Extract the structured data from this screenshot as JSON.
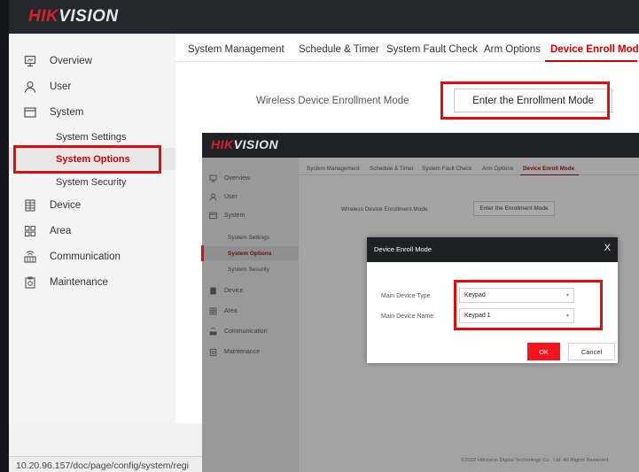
{
  "brand": {
    "logo_hik": "HIK",
    "logo_vision": "VISION"
  },
  "sidebar": {
    "items": [
      {
        "label": "Overview",
        "icon": "monitor-icon"
      },
      {
        "label": "User",
        "icon": "user-icon"
      },
      {
        "label": "System",
        "icon": "window-icon"
      },
      {
        "label": "Device",
        "icon": "device-grid-icon"
      },
      {
        "label": "Area",
        "icon": "area-grid-icon"
      },
      {
        "label": "Communication",
        "icon": "network-icon"
      },
      {
        "label": "Maintenance",
        "icon": "maintenance-icon"
      }
    ],
    "system_subitems": [
      {
        "label": "System Settings",
        "active": false
      },
      {
        "label": "System Options",
        "active": true
      },
      {
        "label": "System Security",
        "active": false
      }
    ]
  },
  "tabs": [
    {
      "label": "System Management",
      "active": false
    },
    {
      "label": "Schedule & Timer",
      "active": false
    },
    {
      "label": "System Fault Check",
      "active": false
    },
    {
      "label": "Arm Options",
      "active": false
    },
    {
      "label": "Device Enroll Mode",
      "active": true
    }
  ],
  "enrollment": {
    "label": "Wireless Device Enrollment Mode",
    "button_label": "Enter the Enrollment Mode"
  },
  "status_url": "10.20.96.157/doc/page/config/system/regi",
  "dialog": {
    "title": "Device Enroll Mode",
    "close_glyph": "X",
    "type_label": "Main Device Type",
    "type_value": "Keypad",
    "name_label": "Main Device Name",
    "name_value": "Keypad 1",
    "ok_label": "OK",
    "cancel_label": "Cancel"
  },
  "footer": "©2022 Hikvision Digital Technology Co., Ltd. All Rights Reserved.",
  "colors": {
    "accent": "#d40000",
    "highlight": "#e4090b",
    "ok_button": "#f8141c"
  }
}
